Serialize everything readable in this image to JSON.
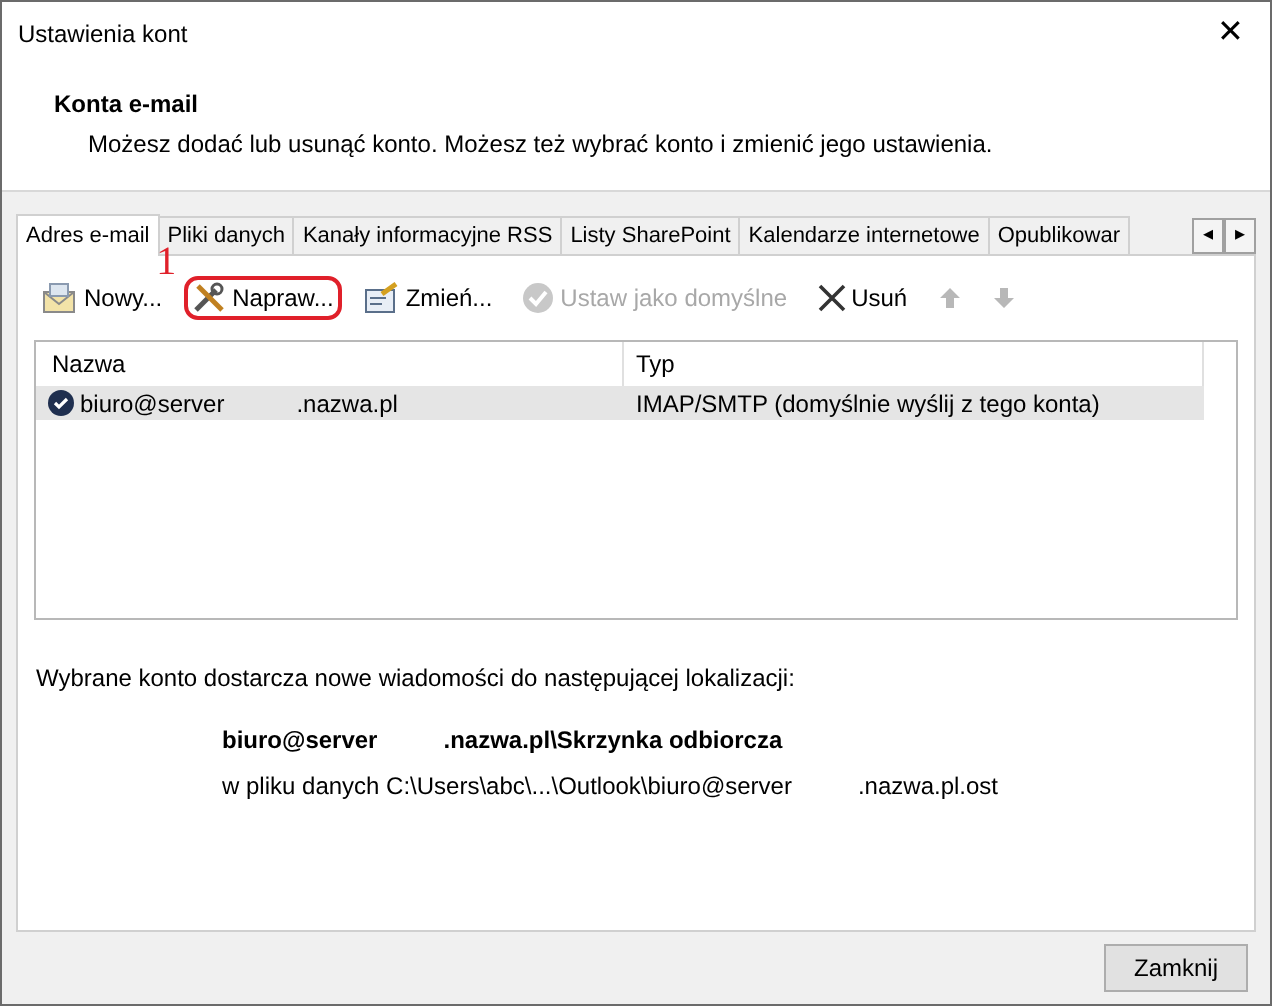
{
  "window": {
    "title": "Ustawienia kont",
    "close": "✕"
  },
  "header": {
    "title": "Konta e-mail",
    "description": "Możesz dodać lub usunąć konto. Możesz też wybrać konto i zmienić jego ustawienia."
  },
  "tabs": [
    {
      "label": "Adres e-mail",
      "selected": true
    },
    {
      "label": "Pliki danych",
      "selected": false
    },
    {
      "label": "Kanały informacyjne RSS",
      "selected": false
    },
    {
      "label": "Listy SharePoint",
      "selected": false
    },
    {
      "label": "Kalendarze internetowe",
      "selected": false
    },
    {
      "label": "Opublikowar",
      "selected": false
    }
  ],
  "tab_scroll": [
    "◂",
    "▸"
  ],
  "toolbar": [
    {
      "kind": "new",
      "label": "Nowy...",
      "disabled": false,
      "highlighted": false
    },
    {
      "kind": "repair",
      "label": "Napraw...",
      "disabled": false,
      "highlighted": true,
      "annotation": "1"
    },
    {
      "kind": "change",
      "label": "Zmień...",
      "disabled": false,
      "highlighted": false
    },
    {
      "kind": "default",
      "label": "Ustaw jako domyślne",
      "disabled": true,
      "highlighted": false
    },
    {
      "kind": "remove",
      "label": "Usuń",
      "disabled": false,
      "highlighted": false
    },
    {
      "kind": "up",
      "disabled": true,
      "highlighted": false
    },
    {
      "kind": "down",
      "disabled": true,
      "highlighted": false
    }
  ],
  "table": {
    "columns": [
      "Nazwa",
      "Typ"
    ],
    "rows": [
      {
        "name_parts": [
          "biuro@server",
          ".nazwa.pl"
        ],
        "type": "IMAP/SMTP (domyślnie wyślij z tego konta)",
        "selected": true,
        "default": true
      }
    ]
  },
  "delivery": {
    "intro": "Wybrane konto dostarcza nowe wiadomości do następującej lokalizacji:",
    "folder_parts": [
      "biuro@server",
      ".nazwa.pl\\Skrzynka odbiorcza"
    ],
    "file_parts": [
      "w pliku danych C:\\Users\\abc\\...\\Outlook\\biuro@server",
      ".nazwa.pl.ost"
    ]
  },
  "buttons": [
    "Zamknij"
  ]
}
